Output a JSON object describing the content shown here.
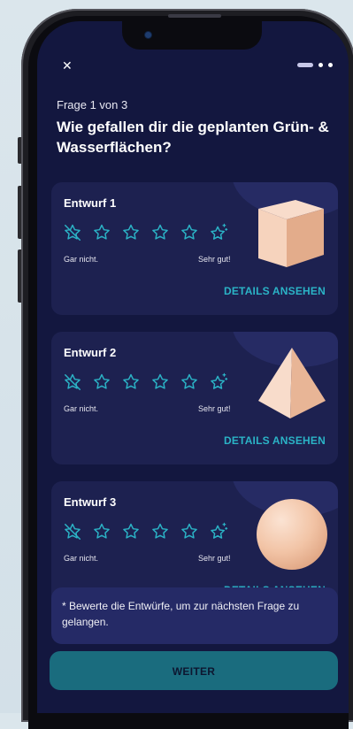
{
  "header": {
    "close_icon": "close-icon",
    "menu_icon": "menu-dots-icon"
  },
  "question": {
    "counter": "Frage 1 von 3",
    "title": "Wie gefallen dir die geplanten Grün- & Wasserflächen?"
  },
  "designs": [
    {
      "title": "Entwurf 1",
      "shape": "cube",
      "rating_low": "Gar nicht.",
      "rating_high": "Sehr gut!",
      "details": "DETAILS ANSEHEN"
    },
    {
      "title": "Entwurf 2",
      "shape": "pyramid",
      "rating_low": "Gar nicht.",
      "rating_high": "Sehr gut!",
      "details": "DETAILS ANSEHEN"
    },
    {
      "title": "Entwurf 3",
      "shape": "sphere",
      "rating_low": "Gar nicht.",
      "rating_high": "Sehr gut!",
      "details": "DETAILS ANSEHEN"
    }
  ],
  "notice": "* Bewerte die Entwürfe, um zur nächsten Frage zu gelangen.",
  "continue_button": "WEITER",
  "colors": {
    "background": "#13173f",
    "card": "#1d2150",
    "accent": "#2bb3c6",
    "button": "#1a6c7e",
    "shape": "#f2c9ad"
  }
}
